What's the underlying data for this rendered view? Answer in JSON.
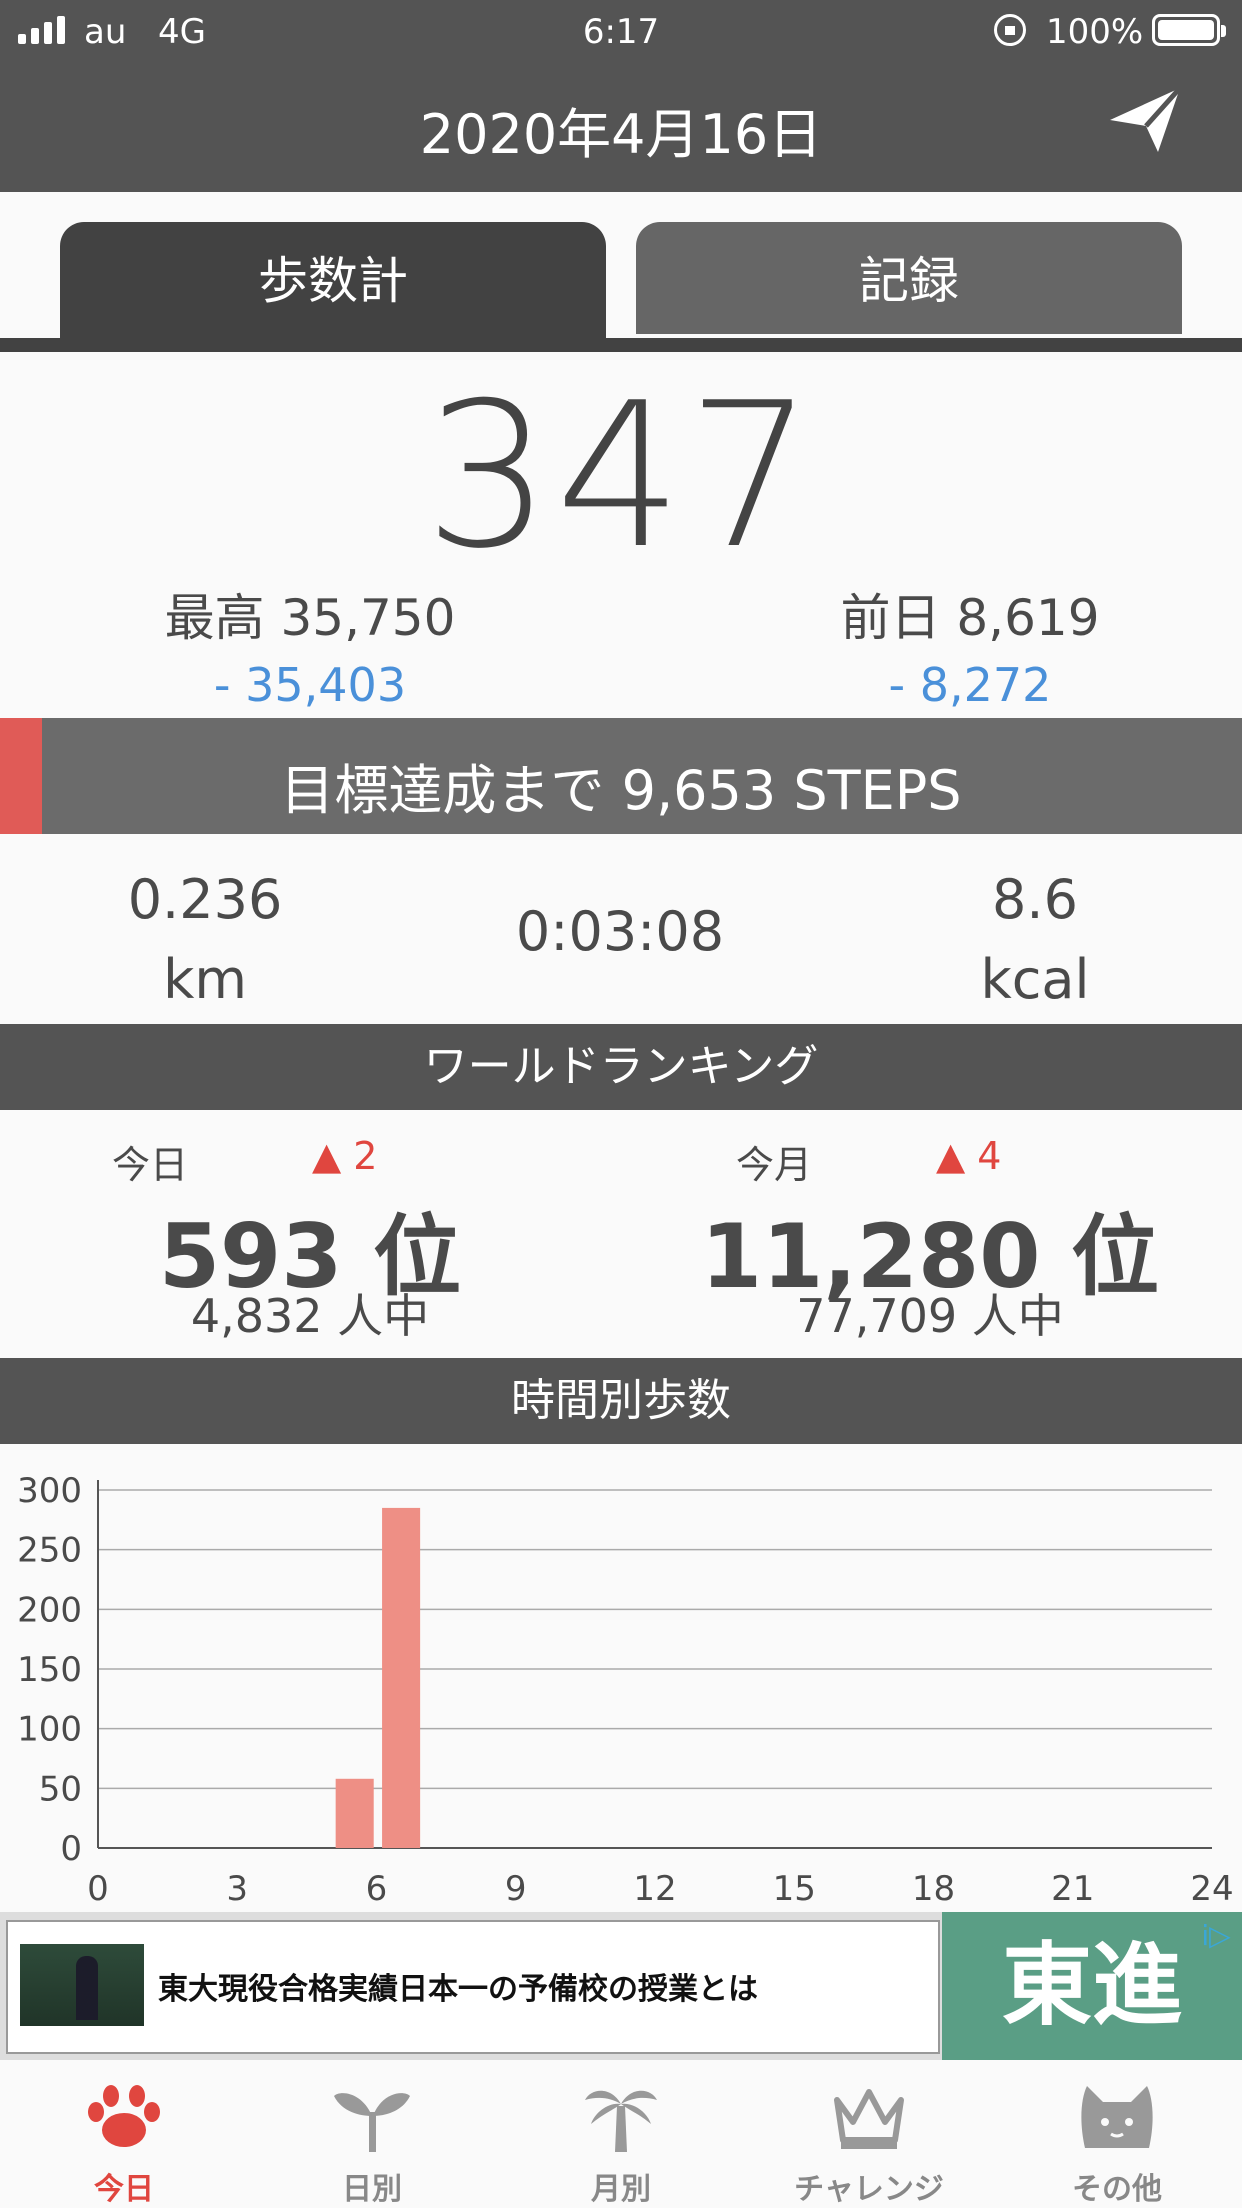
{
  "status_bar": {
    "carrier": "au",
    "network": "4G",
    "time": "6:17",
    "battery": "100%"
  },
  "header": {
    "title": "2020年4月16日"
  },
  "tabs": [
    {
      "label": "歩数計",
      "active": true
    },
    {
      "label": "記録",
      "active": false
    }
  ],
  "steps": {
    "count": "347",
    "best_label": "最高 35,750",
    "best_diff": "- 35,403",
    "prev_label": "前日 8,619",
    "prev_diff": "- 8,272"
  },
  "goal": {
    "text": "目標達成まで 9,653 STEPS"
  },
  "metrics": {
    "distance_value": "0.236",
    "distance_unit": "km",
    "duration": "0:03:08",
    "calories_value": "8.6",
    "calories_unit": "kcal"
  },
  "ranking": {
    "header": "ワールドランキング",
    "today": {
      "label": "今日",
      "change": "▲ 2",
      "position": "593 位",
      "total": "4,832 人中"
    },
    "month": {
      "label": "今月",
      "change": "▲ 4",
      "position": "11,280 位",
      "total": "77,709 人中"
    }
  },
  "hourly": {
    "header": "時間別歩数"
  },
  "chart_data": {
    "type": "bar",
    "x": [
      5,
      6
    ],
    "values": [
      58,
      285
    ],
    "xticks": [
      "0",
      "3",
      "6",
      "9",
      "12",
      "15",
      "18",
      "21",
      "24"
    ],
    "yticks": [
      "300",
      "250",
      "200",
      "150",
      "100",
      "50",
      "0"
    ],
    "xlim": [
      0,
      24
    ],
    "ylim": [
      0,
      300
    ],
    "grid": true,
    "bar_color": "#ee8f85"
  },
  "ad": {
    "text": "東大現役合格実績日本一の予備校の授業とは",
    "brand": "東進",
    "badge": "i▷"
  },
  "tab_bar": [
    {
      "label": "今日",
      "icon": "paw-icon",
      "active": true
    },
    {
      "label": "日別",
      "icon": "sprout-icon",
      "active": false
    },
    {
      "label": "月別",
      "icon": "palm-tree-icon",
      "active": false
    },
    {
      "label": "チャレンジ",
      "icon": "crown-icon",
      "active": false
    },
    {
      "label": "その他",
      "icon": "cat-icon",
      "active": false
    }
  ],
  "colors": {
    "header_bg": "#545454",
    "accent_red": "#e05b57",
    "diff_blue": "#4a90d9",
    "ad_green": "#5a9e85"
  }
}
